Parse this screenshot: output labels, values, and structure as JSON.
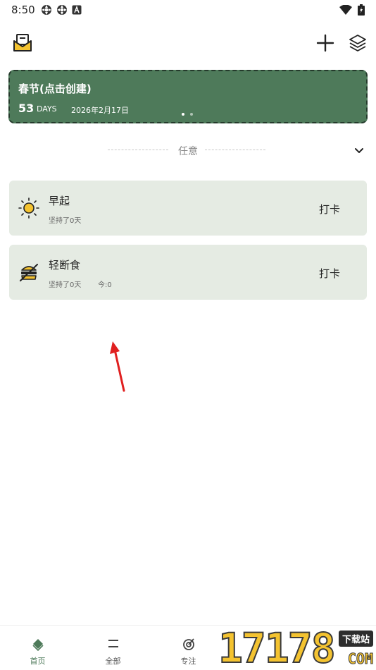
{
  "status_bar": {
    "time": "8:50",
    "left_icons": [
      "settings-gear-icon",
      "settings-gear-icon",
      "a-letter-box-icon"
    ],
    "right_icons": [
      "wifi-icon",
      "battery-charging-icon"
    ]
  },
  "header": {
    "left_icon": "mail-icon",
    "right_icons": [
      "add-icon",
      "layers-icon"
    ]
  },
  "banner": {
    "title": "春节(点击创建)",
    "days": "53",
    "days_unit": "DAYS",
    "date": "2026年2月17日",
    "page_count": 2,
    "active_page": 0,
    "background_color": "#4e7a5a"
  },
  "group": {
    "label": "任意"
  },
  "habits": [
    {
      "title": "早起",
      "streak": "坚持了0天",
      "today": "",
      "action": "打卡",
      "icon": "sun-icon"
    },
    {
      "title": "轻断食",
      "streak": "坚持了0天",
      "today": "今:0",
      "action": "打卡",
      "icon": "no-burger-icon"
    }
  ],
  "bottom_nav": [
    {
      "label": "首页",
      "icon": "home-diamond-icon",
      "active": true
    },
    {
      "label": "全部",
      "icon": "list-icon",
      "active": false
    },
    {
      "label": "专注",
      "icon": "target-icon",
      "active": false
    }
  ],
  "watermark": {
    "number": "17178",
    "tag": "下载站",
    "suffix": "COM"
  },
  "colors": {
    "accent": "#4e7a5a",
    "card_bg": "#e5ebe3",
    "arrow": "#e02020"
  }
}
